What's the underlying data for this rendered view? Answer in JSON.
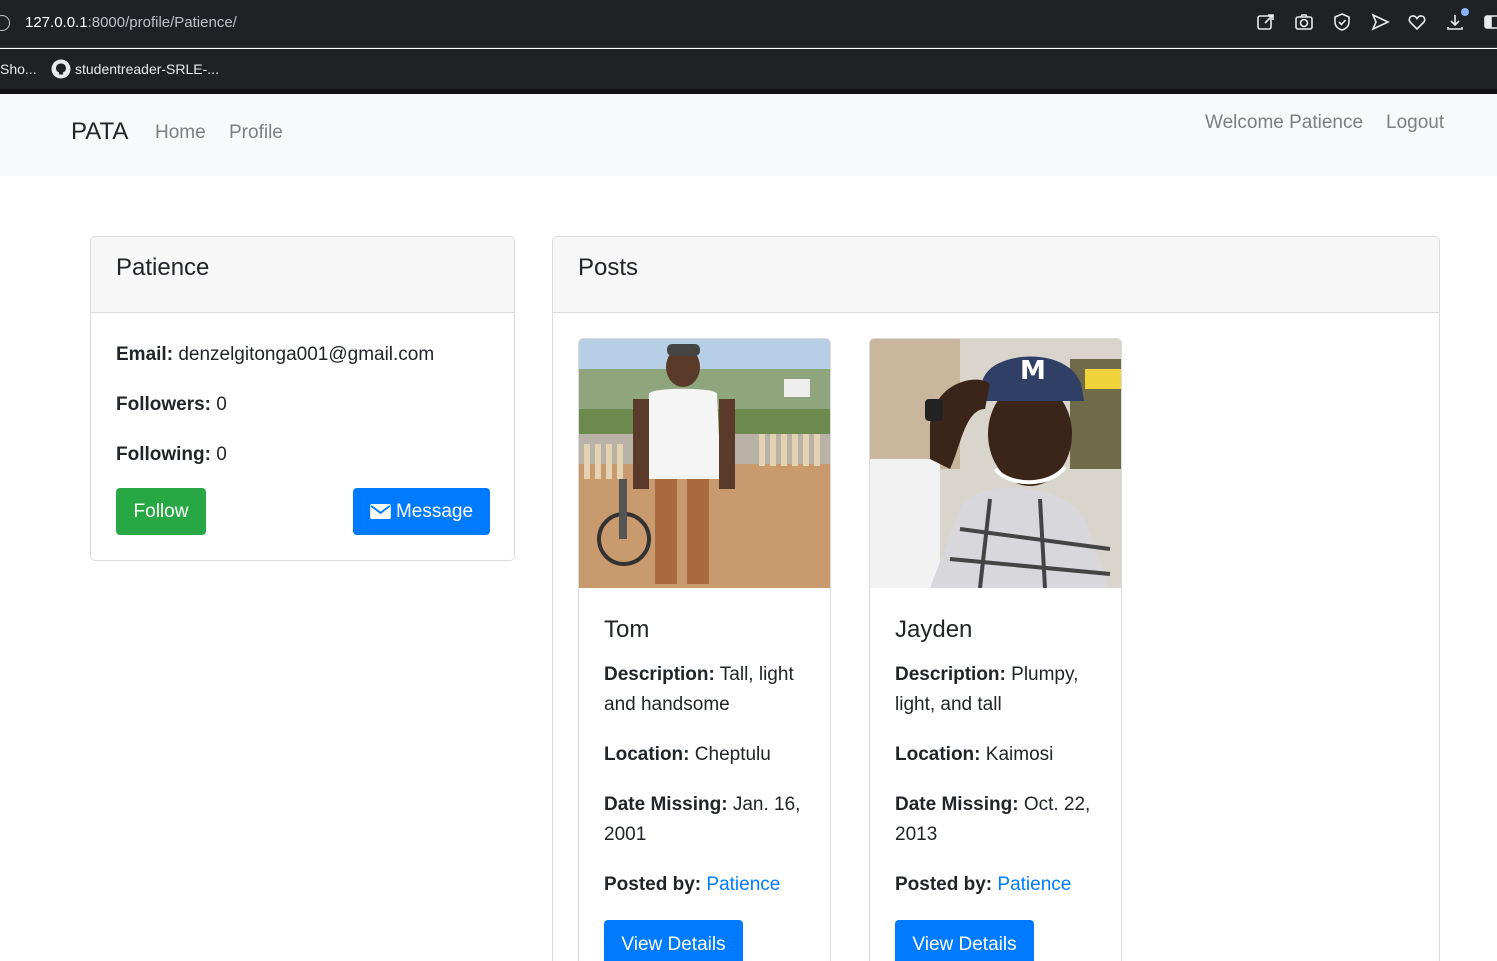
{
  "browser": {
    "url_host": "127.0.0.1",
    "url_path": ":8000/profile/Patience/",
    "bookmarks": [
      {
        "label": "Sho..."
      },
      {
        "label": "studentreader-SRLE-..."
      }
    ],
    "icons": [
      "share-icon",
      "camera-icon",
      "shield-icon",
      "send-icon",
      "heart-icon",
      "download-icon",
      "sidebar-icon"
    ]
  },
  "navbar": {
    "brand": "PATA",
    "links": [
      "Home",
      "Profile"
    ],
    "welcome": "Welcome Patience",
    "logout": "Logout"
  },
  "profile": {
    "name": "Patience",
    "email_label": "Email:",
    "email": "denzelgitonga001@gmail.com",
    "followers_label": "Followers:",
    "followers": "0",
    "following_label": "Following:",
    "following": "0",
    "follow_button": "Follow",
    "message_button": "Message"
  },
  "posts": {
    "title": "Posts",
    "items": [
      {
        "name": "Tom",
        "description_label": "Description:",
        "description": "Tall, light and handsome",
        "location_label": "Location:",
        "location": "Cheptulu",
        "date_label": "Date Missing:",
        "date": "Jan. 16, 2001",
        "posted_label": "Posted by:",
        "posted_by": "Patience",
        "button": "View Details"
      },
      {
        "name": "Jayden",
        "description_label": "Description:",
        "description": "Plumpy, light, and tall",
        "location_label": "Location:",
        "location": "Kaimosi",
        "date_label": "Date Missing:",
        "date": "Oct. 22, 2013",
        "posted_label": "Posted by:",
        "posted_by": "Patience",
        "button": "View Details"
      }
    ]
  },
  "colors": {
    "primary": "#007bff",
    "success": "#28a745",
    "navbar_bg": "#f8f9fa",
    "chrome_bg": "#202124"
  }
}
